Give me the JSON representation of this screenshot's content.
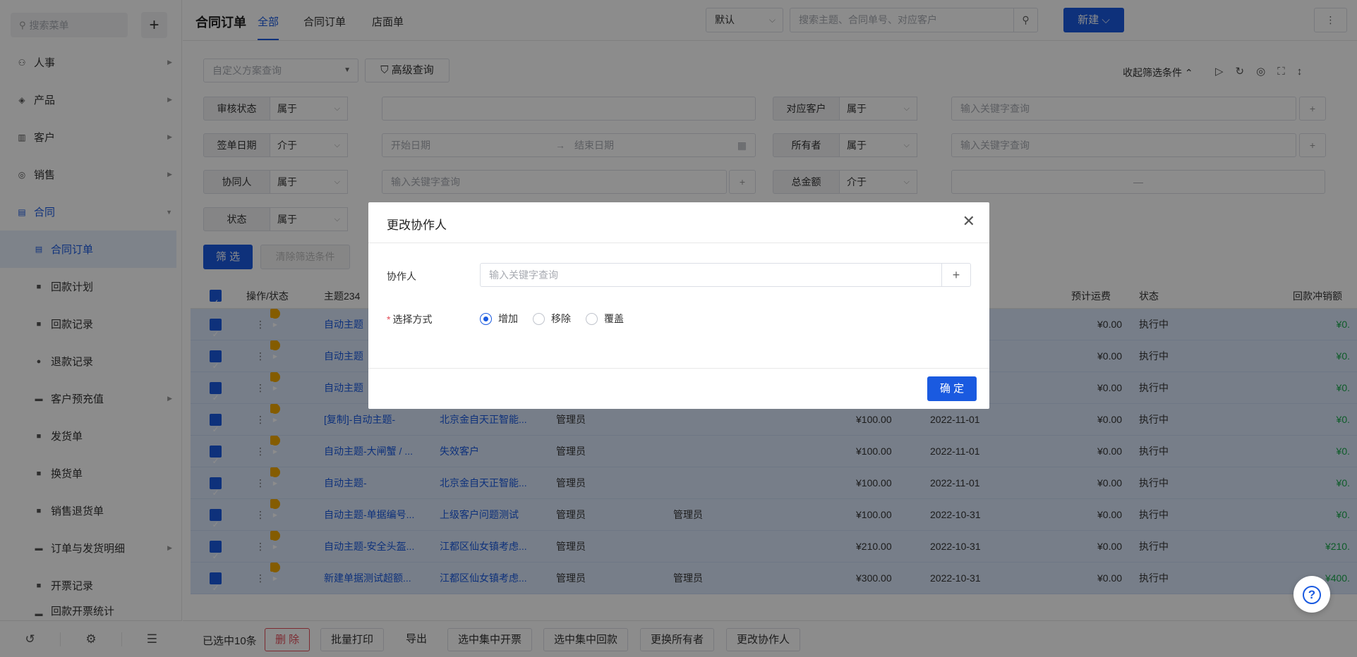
{
  "sidebar": {
    "search_placeholder": "搜索菜单",
    "menu": [
      {
        "label": "人事",
        "icon": "person-icon"
      },
      {
        "label": "产品",
        "icon": "box-icon"
      },
      {
        "label": "客户",
        "icon": "chart-icon"
      },
      {
        "label": "销售",
        "icon": "coin-icon"
      },
      {
        "label": "合同",
        "icon": "document-icon"
      }
    ],
    "sub_menu": [
      {
        "label": "合同订单",
        "active": true
      },
      {
        "label": "回款计划"
      },
      {
        "label": "回款记录"
      },
      {
        "label": "退款记录"
      },
      {
        "label": "客户预充值"
      },
      {
        "label": "发货单"
      },
      {
        "label": "换货单"
      },
      {
        "label": "销售退货单"
      },
      {
        "label": "订单与发货明细"
      },
      {
        "label": "开票记录"
      },
      {
        "label": "回款开票统计"
      }
    ]
  },
  "header": {
    "title": "合同订单",
    "tabs": [
      "全部",
      "合同订单",
      "店面单"
    ],
    "view_select": "默认",
    "search_placeholder": "搜索主题、合同单号、对应客户",
    "new_button": "新建"
  },
  "filters": {
    "scheme_placeholder": "自定义方案查询",
    "advanced_button": "高级查询",
    "collapse_link": "收起筛选条件",
    "rows": [
      {
        "label": "审核状态",
        "op": "属于",
        "value": ""
      },
      {
        "label": "对应客户",
        "op": "属于",
        "value": "输入关键字查询"
      },
      {
        "label": "签单日期",
        "op": "介于",
        "start": "开始日期",
        "end": "结束日期"
      },
      {
        "label": "所有者",
        "op": "属于",
        "value": "输入关键字查询"
      },
      {
        "label": "协同人",
        "op": "属于",
        "value": "输入关键字查询"
      },
      {
        "label": "总金额",
        "op": "介于",
        "value": "—"
      },
      {
        "label": "状态",
        "op": "属于"
      }
    ],
    "filter_button": "筛 选",
    "clear_button": "清除筛选条件"
  },
  "table": {
    "headers": [
      "操作/状态",
      "主题234",
      "预计运费",
      "状态",
      "回款冲销额"
    ],
    "rows": [
      {
        "subject": "自动主题",
        "customer": "",
        "owner": "",
        "collab": "",
        "amount": "",
        "date": "",
        "freight": "¥0.00",
        "status": "执行中",
        "writeoff": "¥0."
      },
      {
        "subject": "自动主题",
        "customer": "",
        "owner": "",
        "collab": "",
        "amount": "",
        "date": "",
        "freight": "¥0.00",
        "status": "执行中",
        "writeoff": "¥0."
      },
      {
        "subject": "自动主题",
        "customer": "",
        "owner": "",
        "collab": "",
        "amount": "",
        "date": "",
        "freight": "¥0.00",
        "status": "执行中",
        "writeoff": "¥0."
      },
      {
        "subject": "[复制]-自动主题-",
        "customer": "北京金自天正智能...",
        "owner": "管理员",
        "collab": "",
        "amount": "¥100.00",
        "date": "2022-11-01",
        "freight": "¥0.00",
        "status": "执行中",
        "writeoff": "¥0."
      },
      {
        "subject": "自动主题-大闸蟹 / ...",
        "customer": "失效客户",
        "owner": "管理员",
        "collab": "",
        "amount": "¥100.00",
        "date": "2022-11-01",
        "freight": "¥0.00",
        "status": "执行中",
        "writeoff": "¥0."
      },
      {
        "subject": "自动主题-",
        "customer": "北京金自天正智能...",
        "owner": "管理员",
        "collab": "",
        "amount": "¥100.00",
        "date": "2022-11-01",
        "freight": "¥0.00",
        "status": "执行中",
        "writeoff": "¥0."
      },
      {
        "subject": "自动主题-单据编号...",
        "customer": "上级客户问题测试",
        "owner": "管理员",
        "collab": "管理员",
        "amount": "¥100.00",
        "date": "2022-10-31",
        "freight": "¥0.00",
        "status": "执行中",
        "writeoff": "¥0."
      },
      {
        "subject": "自动主题-安全头盔...",
        "customer": "江都区仙女镇考虑...",
        "owner": "管理员",
        "collab": "",
        "amount": "¥210.00",
        "date": "2022-10-31",
        "freight": "¥0.00",
        "status": "执行中",
        "writeoff": "¥210."
      },
      {
        "subject": "新建单据测试超额...",
        "customer": "江都区仙女镇考虑...",
        "owner": "管理员",
        "collab": "管理员",
        "amount": "¥300.00",
        "date": "2022-10-31",
        "freight": "¥0.00",
        "status": "执行中",
        "writeoff": "¥400."
      }
    ]
  },
  "bottom_bar": {
    "selected_text": "已选中10条",
    "delete": "删 除",
    "batch_print": "批量打印",
    "export": "导出",
    "invoice": "选中集中开票",
    "collect": "选中集中回款",
    "change_owner": "更换所有者",
    "change_collab": "更改协作人"
  },
  "modal": {
    "title": "更改协作人",
    "collab_label": "协作人",
    "collab_placeholder": "输入关键字查询",
    "method_label": "选择方式",
    "options": [
      "增加",
      "移除",
      "覆盖"
    ],
    "selected_option": "增加",
    "confirm": "确 定"
  },
  "colors": {
    "primary": "#1a5ae0",
    "danger": "#e34d59",
    "success": "#1aa84c",
    "selected_row": "#d9e6fa"
  }
}
